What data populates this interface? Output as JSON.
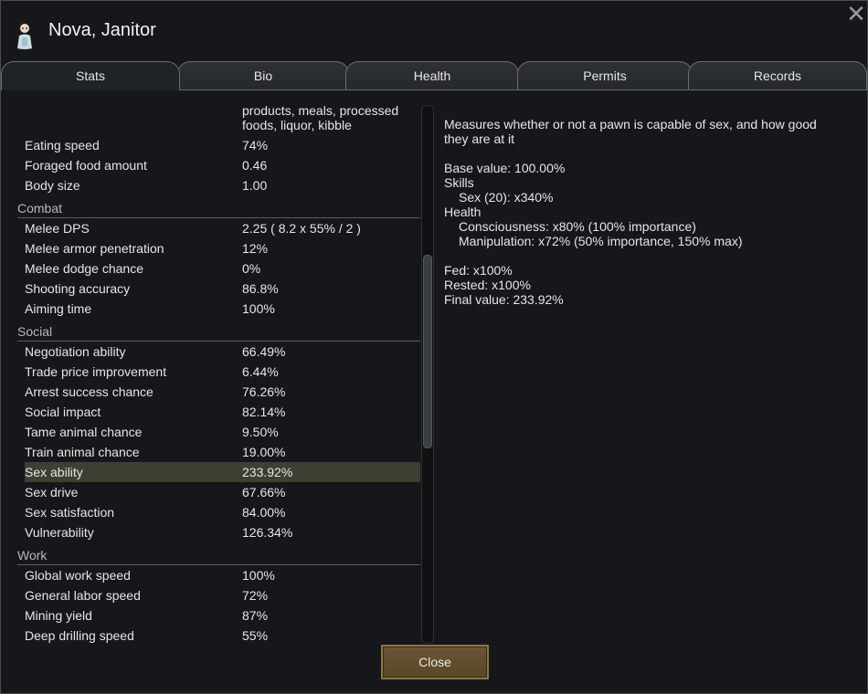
{
  "window": {
    "title": "Nova, Janitor"
  },
  "tabs": [
    {
      "label": "Stats"
    },
    {
      "label": "Bio"
    },
    {
      "label": "Health"
    },
    {
      "label": "Permits"
    },
    {
      "label": "Records"
    }
  ],
  "stats": {
    "wrapped_value": "products, meals, processed foods, liquor, kibble",
    "rows_a": [
      {
        "label": "Eating speed",
        "value": "74%"
      },
      {
        "label": "Foraged food amount",
        "value": "0.46"
      },
      {
        "label": "Body size",
        "value": "1.00"
      }
    ],
    "combat": {
      "label": "Combat",
      "rows": [
        {
          "label": "Melee DPS",
          "value": "2.25 ( 8.2 x 55% / 2 )"
        },
        {
          "label": "Melee armor penetration",
          "value": "12%"
        },
        {
          "label": "Melee dodge chance",
          "value": "0%"
        },
        {
          "label": "Shooting accuracy",
          "value": "86.8%"
        },
        {
          "label": "Aiming time",
          "value": "100%"
        }
      ]
    },
    "social": {
      "label": "Social",
      "rows": [
        {
          "label": "Negotiation ability",
          "value": "66.49%"
        },
        {
          "label": "Trade price improvement",
          "value": "6.44%"
        },
        {
          "label": "Arrest success chance",
          "value": "76.26%"
        },
        {
          "label": "Social impact",
          "value": "82.14%"
        },
        {
          "label": "Tame animal chance",
          "value": "9.50%"
        },
        {
          "label": "Train animal chance",
          "value": "19.00%"
        },
        {
          "label": "Sex ability",
          "value": "233.92%"
        },
        {
          "label": "Sex drive",
          "value": "67.66%"
        },
        {
          "label": "Sex satisfaction",
          "value": "84.00%"
        },
        {
          "label": "Vulnerability",
          "value": "126.34%"
        }
      ]
    },
    "work": {
      "label": "Work",
      "rows": [
        {
          "label": "Global work speed",
          "value": "100%"
        },
        {
          "label": "General labor speed",
          "value": "72%"
        },
        {
          "label": "Mining yield",
          "value": "87%"
        },
        {
          "label": "Deep drilling speed",
          "value": "55%"
        }
      ]
    }
  },
  "details": {
    "description_1": "Measures whether or not a pawn is capable of sex, and how good",
    "description_2": "they are at it",
    "base_value": "Base value: 100.00%",
    "skills_header": "Skills",
    "skill_sex": "Sex (20): x340%",
    "health_header": "Health",
    "consciousness": "Consciousness: x80% (100% importance)",
    "manipulation": "Manipulation: x72% (50% importance, 150% max)",
    "fed": "Fed: x100%",
    "rested": "Rested: x100%",
    "final_value": "Final value: 233.92%"
  },
  "buttons": {
    "close": "Close"
  },
  "colors": {
    "background": "#15171a",
    "selected_row": "#3f3e33",
    "button": "#5f4b2d"
  }
}
